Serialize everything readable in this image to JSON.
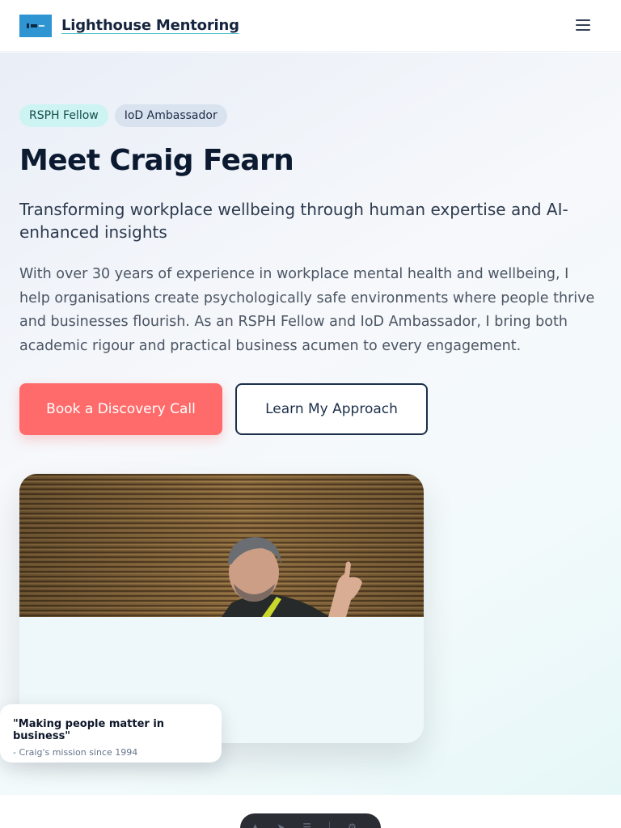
{
  "header": {
    "brand": "Lighthouse Mentoring",
    "logo_icon": "lighthouse-logo-icon",
    "menu_icon": "hamburger-menu-icon"
  },
  "hero": {
    "badges": [
      "RSPH Fellow",
      "IoD Ambassador"
    ],
    "title": "Meet Craig Fearn",
    "subtitle": "Transforming workplace wellbeing through human expertise and AI-enhanced insights",
    "body": "With over 30 years of experience in workplace mental health and wellbeing, I help organisations create psychologically safe environments where people thrive and businesses flourish. As an RSPH Fellow and IoD Ambassador, I bring both academic rigour and practical business acumen to every engagement.",
    "primary_cta": "Book a Discovery Call",
    "secondary_cta": "Learn My Approach"
  },
  "quote": {
    "text": "\"Making people matter in business\"",
    "sub": "- Craig's mission since 1994"
  },
  "colors": {
    "accent": "#ff6b6b",
    "navy": "#1c2f4a",
    "teal_badge": "#cdf3f2",
    "blue_badge": "#d9e3f0"
  },
  "toolbar": {
    "icons": [
      "cursor-icon",
      "send-icon",
      "menu-lines-icon",
      "gear-icon"
    ]
  }
}
